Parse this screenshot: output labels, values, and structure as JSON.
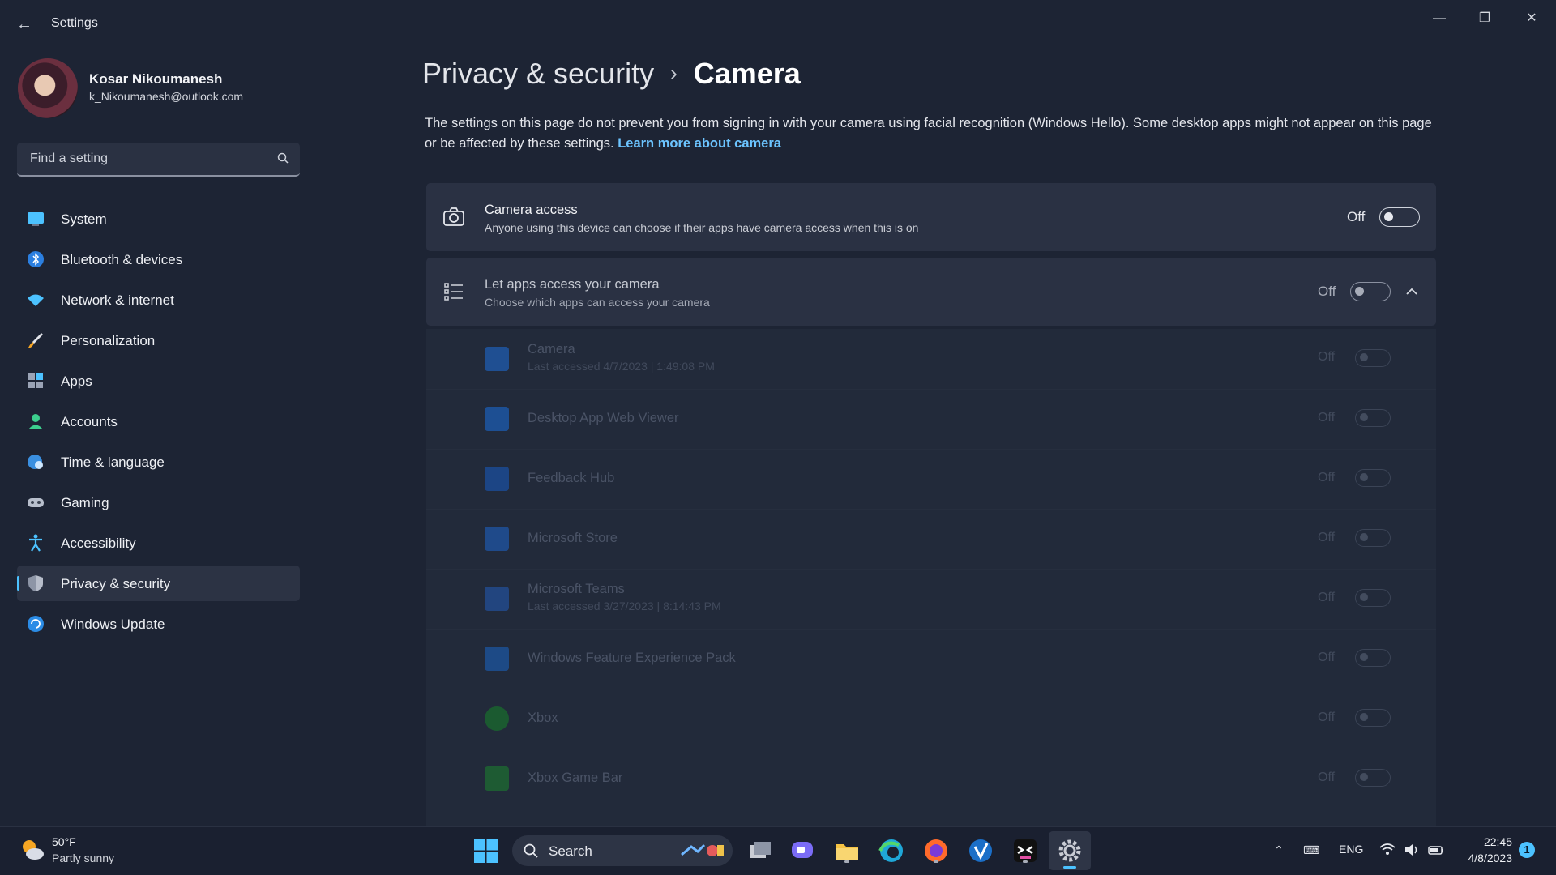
{
  "window": {
    "title": "Settings",
    "controls": [
      "minimize",
      "restore",
      "close"
    ]
  },
  "profile": {
    "name": "Kosar Nikoumanesh",
    "email": "k_Nikoumanesh@outlook.com"
  },
  "search": {
    "placeholder": "Find a setting"
  },
  "sidebar": {
    "items": [
      {
        "label": "System",
        "icon": "monitor-icon"
      },
      {
        "label": "Bluetooth & devices",
        "icon": "bluetooth-icon"
      },
      {
        "label": "Network & internet",
        "icon": "wifi-icon"
      },
      {
        "label": "Personalization",
        "icon": "brush-icon"
      },
      {
        "label": "Apps",
        "icon": "apps-icon"
      },
      {
        "label": "Accounts",
        "icon": "person-icon"
      },
      {
        "label": "Time & language",
        "icon": "globe-clock-icon"
      },
      {
        "label": "Gaming",
        "icon": "gamepad-icon"
      },
      {
        "label": "Accessibility",
        "icon": "accessibility-icon"
      },
      {
        "label": "Privacy & security",
        "icon": "shield-icon",
        "active": true
      },
      {
        "label": "Windows Update",
        "icon": "update-icon"
      }
    ]
  },
  "main": {
    "breadcrumb_parent": "Privacy & security",
    "breadcrumb_current": "Camera",
    "description": "The settings on this page do not prevent you from signing in with your camera using facial recognition (Windows Hello). Some desktop apps might not appear on this page or be affected by these settings.",
    "learn_more": "Learn more about camera",
    "camera_access": {
      "title": "Camera access",
      "subtitle": "Anyone using this device can choose if their apps have camera access when this is on",
      "state": "Off"
    },
    "let_apps": {
      "title": "Let apps access your camera",
      "subtitle": "Choose which apps can access your camera",
      "state": "Off"
    },
    "apps": [
      {
        "name": "Camera",
        "meta": "Last accessed 4/7/2023  |  1:49:08 PM",
        "state": "Off",
        "color": "#2b6fd6"
      },
      {
        "name": "Desktop App Web Viewer",
        "meta": "",
        "state": "Off",
        "color": "#1e6fd9"
      },
      {
        "name": "Feedback Hub",
        "meta": "",
        "state": "Off",
        "color": "#1f5fbf"
      },
      {
        "name": "Microsoft Store",
        "meta": "",
        "state": "Off",
        "color": "#2a6acb"
      },
      {
        "name": "Microsoft Teams",
        "meta": "Last accessed 3/27/2023  |  8:14:43 PM",
        "state": "Off",
        "color": "#2f62c2"
      },
      {
        "name": "Windows Feature Experience Pack",
        "meta": "",
        "state": "Off",
        "color": "#2568c8"
      },
      {
        "name": "Xbox",
        "meta": "",
        "state": "Off",
        "color": "#1f8a3a"
      },
      {
        "name": "Xbox Game Bar",
        "meta": "",
        "state": "Off",
        "color": "#2b8a45"
      }
    ]
  },
  "taskbar": {
    "weather_temp": "50°F",
    "weather_desc": "Partly sunny",
    "search_label": "Search",
    "language": "ENG",
    "time": "22:45",
    "date": "4/8/2023",
    "notification_count": "1"
  },
  "colors": {
    "accent": "#4cc2ff",
    "link": "#6cc4ff",
    "card": "#2a3143",
    "background": "#1d2434"
  }
}
